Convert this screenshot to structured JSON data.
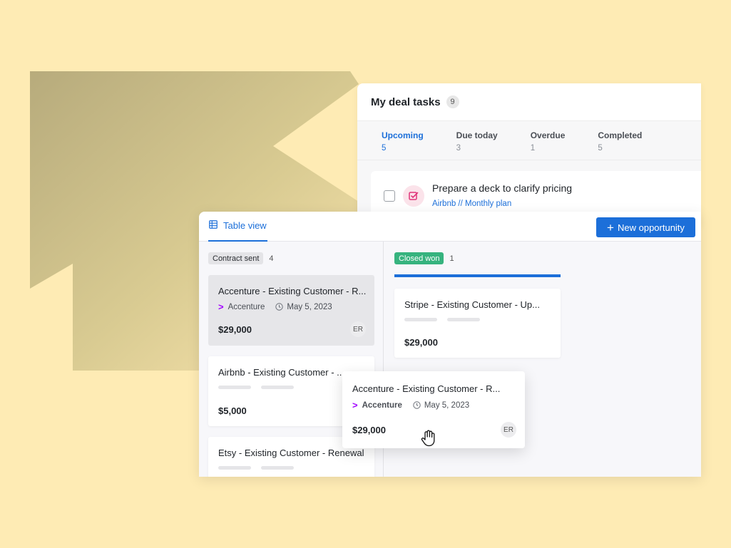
{
  "colors": {
    "background": "#FEEBB4",
    "decor_shape": "#C9BC86",
    "accent": "#1C6FD9",
    "closed_won": "#36B37E",
    "accenture_brand": "#A100FF",
    "task_icon": "#E0357A"
  },
  "tasks_panel": {
    "title": "My deal tasks",
    "count": "9",
    "tabs": [
      {
        "label": "Upcoming",
        "count": "5",
        "active": true
      },
      {
        "label": "Due today",
        "count": "3",
        "active": false
      },
      {
        "label": "Overdue",
        "count": "1",
        "active": false
      },
      {
        "label": "Completed",
        "count": "5",
        "active": false
      }
    ],
    "task": {
      "title": "Prepare a deck to clarify pricing",
      "link": "Airbnb // Monthly plan",
      "icon": "task-check-icon"
    }
  },
  "board": {
    "view_tab": {
      "label": "Table view",
      "icon": "table-icon"
    },
    "new_button": {
      "label": "New opportunity",
      "icon": "plus-icon"
    },
    "columns": [
      {
        "stage": "Contract sent",
        "count": "4"
      },
      {
        "stage": "Closed won",
        "count": "1"
      }
    ],
    "cards": [
      {
        "title": "Accenture - Existing Customer - R...",
        "company": "Accenture",
        "date": "May 5, 2023",
        "amount": "$29,000",
        "owner": "ER"
      },
      {
        "title": "Airbnb - Existing Customer - ..",
        "amount": "$5,000"
      },
      {
        "title": "Etsy - Existing Customer - Renewal"
      },
      {
        "title": "Stripe - Existing Customer - Up...",
        "amount": "$29,000"
      }
    ],
    "dragged_card": {
      "title": "Accenture - Existing Customer - R...",
      "company": "Accenture",
      "date": "May 5, 2023",
      "amount": "$29,000",
      "owner": "ER"
    },
    "cursor": "grab-hand-icon"
  }
}
